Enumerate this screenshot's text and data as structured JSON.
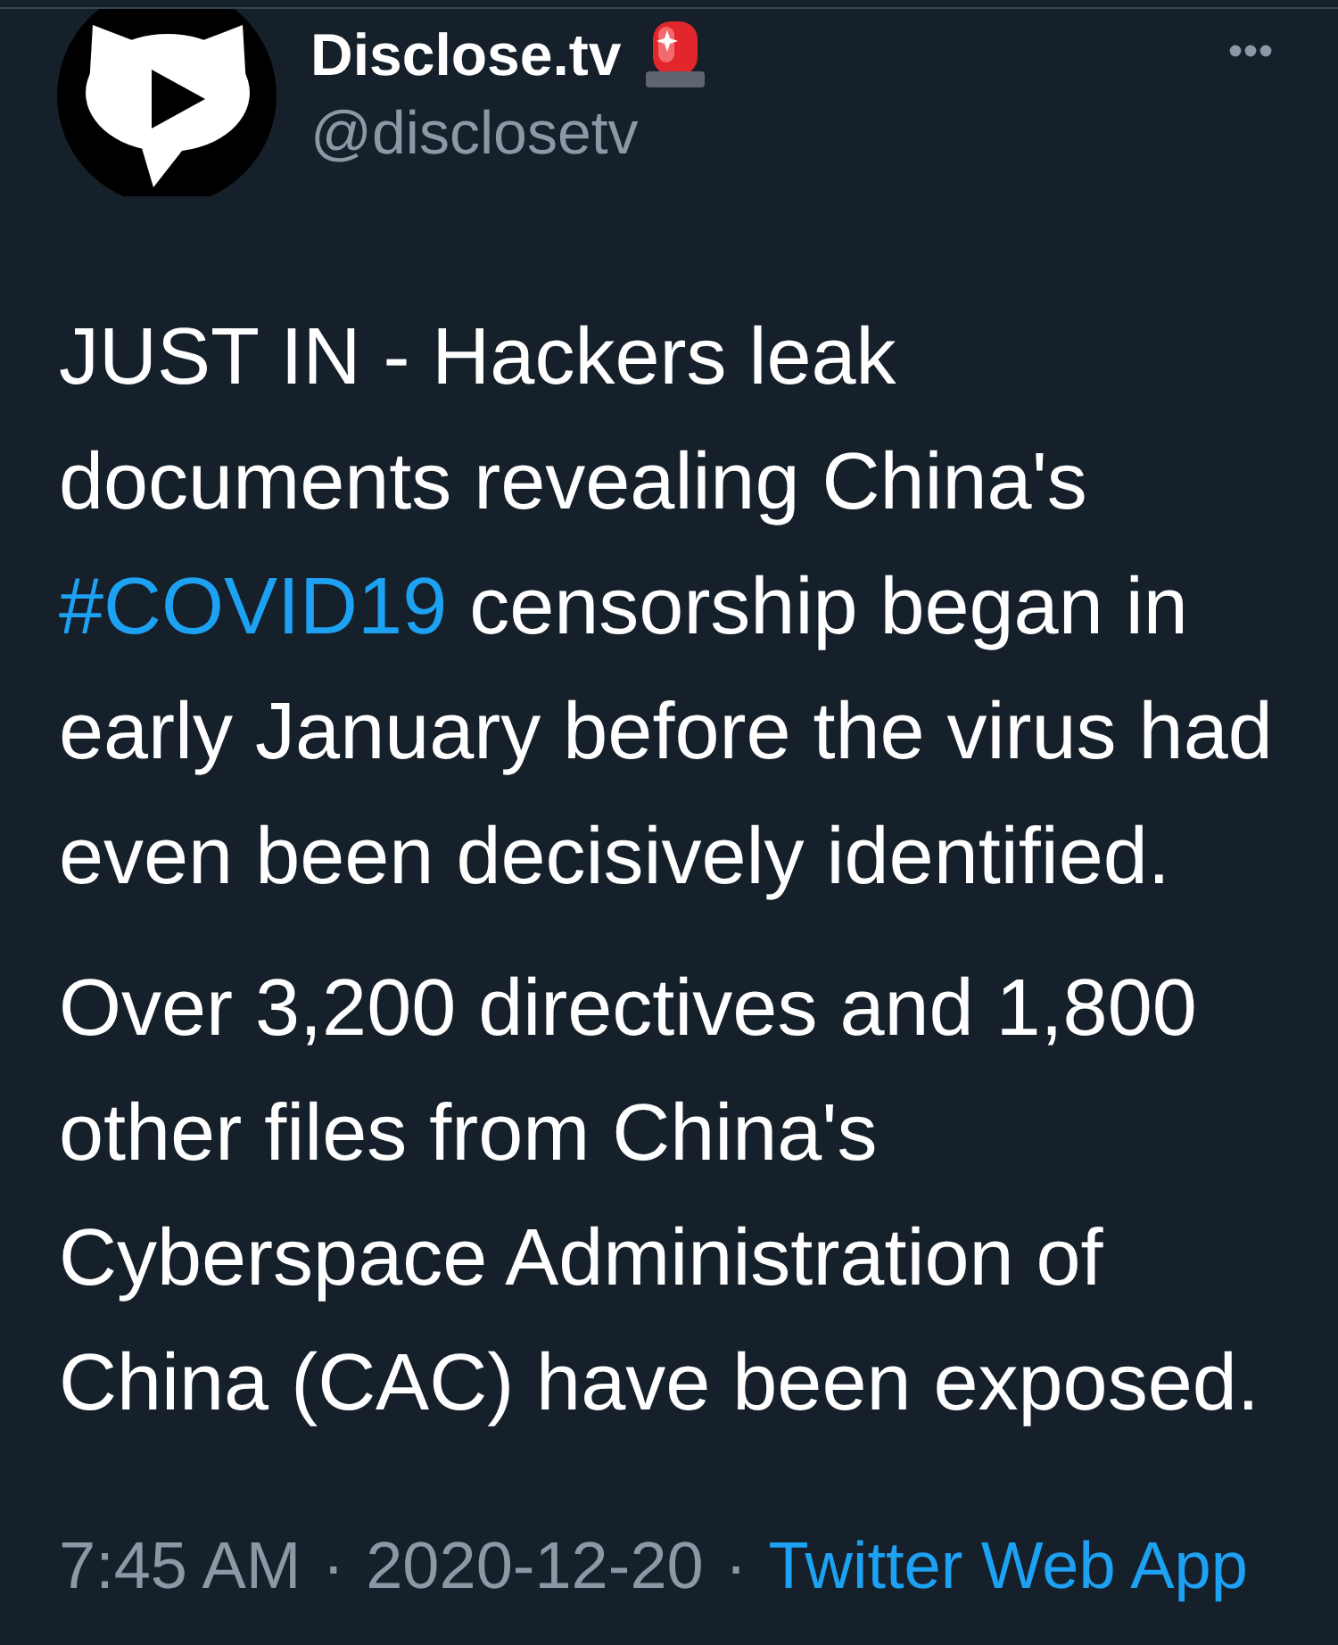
{
  "header": {
    "name": "Disclose.tv",
    "handle": "@disclosetv"
  },
  "tweet": {
    "paragraphs": [
      {
        "segments": [
          {
            "kind": "text",
            "text": "JUST IN - Hackers leak documents revealing China's "
          },
          {
            "kind": "hashtag",
            "text": "#COVID19"
          },
          {
            "kind": "text",
            "text": " censorship began in early January before the virus had even been decisively identified."
          }
        ]
      },
      {
        "segments": [
          {
            "kind": "text",
            "text": "Over 3,200 directives and 1,800 other files from China's Cyberspace Administration of China (CAC) have been exposed."
          }
        ]
      }
    ]
  },
  "footer": [
    {
      "kind": "time",
      "text": "7:45 AM"
    },
    {
      "kind": "separator",
      "text": "·"
    },
    {
      "kind": "date",
      "text": "2020-12-20"
    },
    {
      "kind": "separator",
      "text": "·"
    },
    {
      "kind": "link",
      "text": "Twitter Web App"
    }
  ]
}
